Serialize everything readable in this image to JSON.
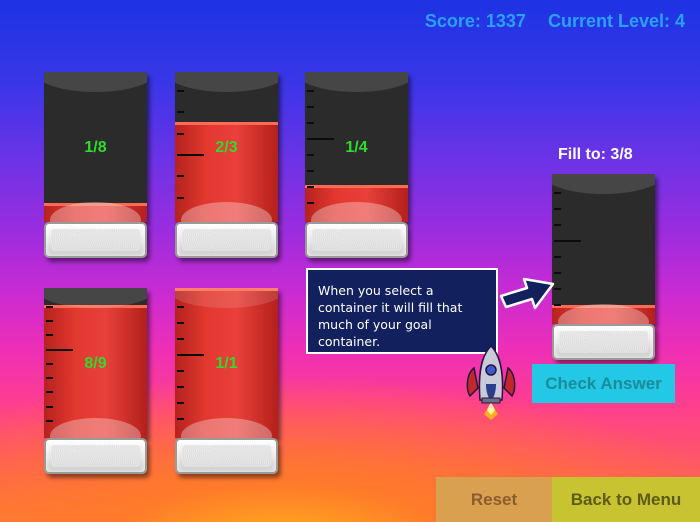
{
  "hud": {
    "score": "Score: 1337",
    "level": "Current Level: 4"
  },
  "containers": [
    {
      "label": "1/8",
      "fill": 0.125,
      "ticks": 0,
      "big": 0
    },
    {
      "label": "2/3",
      "fill": 0.667,
      "ticks": 6,
      "big": 4
    },
    {
      "label": "1/4",
      "fill": 0.25,
      "ticks": 8,
      "big": 4
    },
    {
      "label": "8/9",
      "fill": 0.889,
      "ticks": 9,
      "big": 4
    },
    {
      "label": "1/1",
      "fill": 1.0,
      "ticks": 8,
      "big": 4
    }
  ],
  "goal": {
    "caption": "Fill to: 3/8",
    "fill": 0.125,
    "ticks": 8,
    "big": 4
  },
  "hint": {
    "text": "When you select a container it will fill that much of your goal container."
  },
  "buttons": {
    "check": "Check Answer",
    "reset": "Reset",
    "menu": "Back to Menu"
  },
  "colors": {
    "liquid": "#e2382f",
    "label": "#2edc2e",
    "hud": "#2aa1ff",
    "check": "#23c8e6",
    "reset": "#d9a14f",
    "menu": "#c8c431"
  }
}
